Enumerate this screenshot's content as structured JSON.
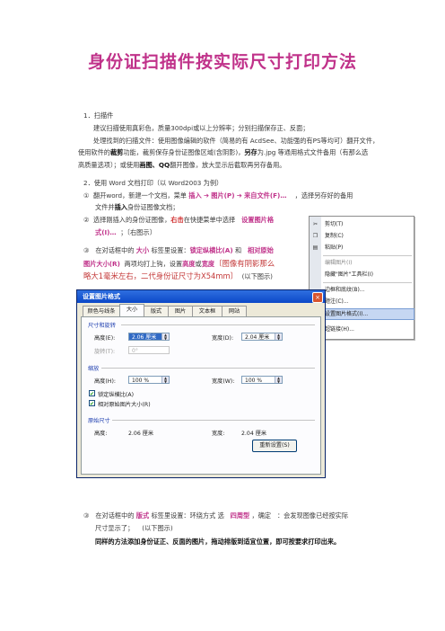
{
  "title": "身份证扫描件按实际尺寸打印方法",
  "section1": {
    "heading": "1．扫描件",
    "line1": "建议扫描使用真彩色，质量300dpi或以上分辨率；分别扫描保存正、反面；",
    "line2": "处理找到的扫描文件：使用图像编辑的软件（简易的有 AcdSee、功能强的有PS等均可）翻开文件，",
    "line3a": "使用软件的",
    "line3b": "裁剪",
    "line3c": "功能，裁剪保存身份证图像区域(含阴影)，",
    "line3d": "另存",
    "line3e": "为.jpg 等通用格式文件备用（有那么选",
    "line4a": "高质量选项）；或使用",
    "line4b": "画图、QQ",
    "line4c": "翻开图像，放大显示后截取再另存备用。"
  },
  "section2": {
    "heading": "2．使用 Word  文档打印（以 Word2003 为例）",
    "step1_num": "①",
    "step1a": "翻开word，新建一个文档，菜单",
    "step1b": "插入",
    "step1c": "➔",
    "step1d": "图片(P)",
    "step1e": "➔",
    "step1f": "来自文件(F)…",
    "step1g": "，选择另存好的备用",
    "step1_l2a": "文件并",
    "step1_l2b": "插入",
    "step1_l2c": "身份证图像文档；",
    "step2_num": "②",
    "step2a": "选择刚插入的身份证图像，",
    "step2b": "右击",
    "step2c": "在快捷菜单中选择",
    "step2d": "设置图片格",
    "step2_l2a": "式(I)…",
    "step2_l2b": "；〔右图示〕",
    "step3_num": "③",
    "step3a": "在对话框中的",
    "step3b": "大小",
    "step3c": "标签里设置：",
    "step3d": "锁定纵横比(A)",
    "step3e": "和",
    "step3f": "相对原始",
    "step3_l2a": "图片大小(R)",
    "step3_l2b": "两项均打上钩，设置",
    "step3_l2c": "高度",
    "step3_l2d": "或",
    "step3_l2e": "宽度",
    "step3_l2f": "〔图像有阴影那么",
    "step3_l3a": "略大1毫米左右，二代身份证尺寸为X54mm〕",
    "step3_l3b": "(以下图示)",
    "step4_num": "③",
    "step4a": "在对话框中的",
    "step4b": "版式",
    "step4c": "标签里设置：环绕方式  选",
    "step4d": "四周型",
    "step4e": "，确定",
    "step4f": "：会发现图像已经按实际",
    "step4_l2a": "尺寸显示了；",
    "step4_l2b": "(以下图示)",
    "final": "同样的方法添加身份证正、反面的图片，拖动排版到适宜位置，即可按要求打印出来。"
  },
  "context_menu": {
    "items": [
      {
        "label": "剪切(T)",
        "icon": "✂",
        "dim": false
      },
      {
        "label": "复制(C)",
        "icon": "❐",
        "dim": false
      },
      {
        "label": "粘贴(P)",
        "icon": "▤",
        "dim": false
      },
      {
        "label": "编辑图片(I)",
        "icon": "",
        "dim": true
      },
      {
        "label": "隐藏\"图片\"工具栏(I)",
        "icon": "",
        "dim": false
      },
      {
        "label": "边框和底纹(B)...",
        "icon": "",
        "dim": false
      },
      {
        "label": "题注(C)...",
        "icon": "",
        "dim": false
      },
      {
        "label": "设置图片格式(I)...",
        "icon": "▣",
        "dim": false
      },
      {
        "label": "超链接(H)...",
        "icon": "🌐",
        "dim": false
      }
    ]
  },
  "dialog": {
    "title": "设置图片格式",
    "close": "×",
    "tabs": [
      "颜色与线条",
      "大小",
      "版式",
      "图片",
      "文本框",
      "网站"
    ],
    "size_section": "尺寸和旋转",
    "height_label": "高度(E):",
    "height_value": "2.06 厘米",
    "width_label": "宽度(D):",
    "width_value": "2.04 厘米",
    "rotate_label": "旋转(T):",
    "rotate_value": "0°",
    "scale_section": "缩放",
    "scale_h_label": "高度(H):",
    "scale_h_value": "100 %",
    "scale_w_label": "宽度(W):",
    "scale_w_value": "100 %",
    "lock_aspect": "锁定纵横比(A)",
    "relative_size": "相对原始图片大小(R)",
    "original_section": "原始尺寸",
    "orig_h_label": "高度:",
    "orig_h_value": "2.06 厘米",
    "orig_w_label": "宽度:",
    "orig_w_value": "2.04 厘米",
    "reset_button": "重新设置(S)"
  }
}
